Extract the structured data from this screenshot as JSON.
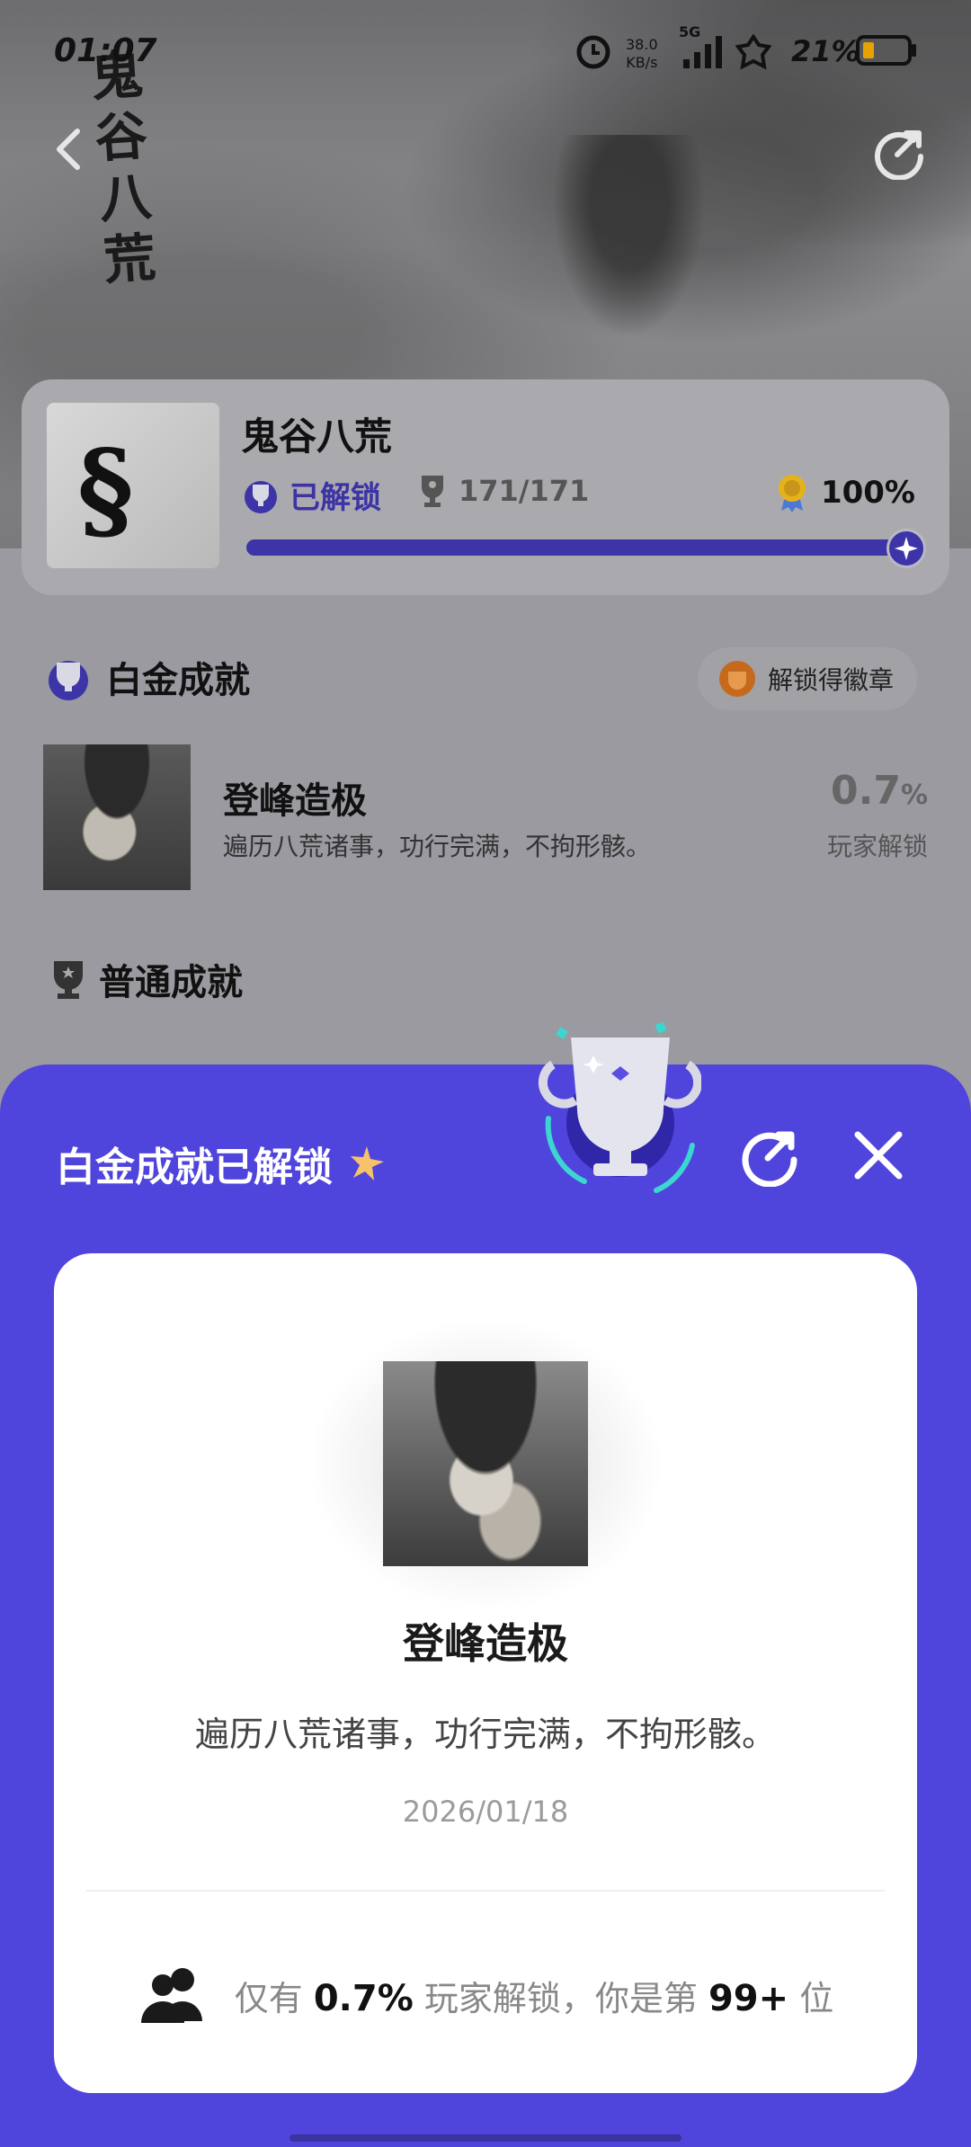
{
  "status_bar": {
    "time": "01:07",
    "net_speed_value": "38.0",
    "net_speed_unit": "KB/s",
    "network": "5G",
    "battery": "21%"
  },
  "hero": {
    "calligraphy": "鬼谷八荒"
  },
  "game": {
    "title": "鬼谷八荒",
    "unlock_status": "已解锁",
    "trophy_progress": "171/171",
    "completion": "100%",
    "progress_fraction": 1.0
  },
  "platinum_section": {
    "title": "白金成就",
    "badge_button": "解锁得徽章",
    "achievement": {
      "name": "登峰造极",
      "description": "遍历八荒诸事，功行完满，不拘形骸。",
      "percent": "0.7",
      "percent_sign": "%",
      "percent_label": "玩家解锁"
    }
  },
  "normal_section": {
    "title": "普通成就"
  },
  "popup": {
    "title": "白金成就已解锁",
    "achievement_name": "登峰造极",
    "achievement_desc": "遍历八荒诸事，功行完满，不拘形骸。",
    "date": "2026/01/18",
    "footer_prefix": "仅有",
    "footer_pct": "0.7%",
    "footer_middle": "玩家解锁，你是第",
    "footer_rank": "99+",
    "footer_suffix": "位"
  },
  "colors": {
    "accent": "#4f44dc",
    "accent_dark": "#3d34a8",
    "card_bg": "#ffffff"
  },
  "icons": {
    "back": "chevron-left-icon",
    "share": "share-icon",
    "close": "close-icon",
    "platinum": "platinum-trophy-icon",
    "trophy": "trophy-icon",
    "medal": "medal-icon",
    "badge": "badge-icon",
    "users": "users-icon",
    "sparkle": "sparkle-star-icon"
  }
}
